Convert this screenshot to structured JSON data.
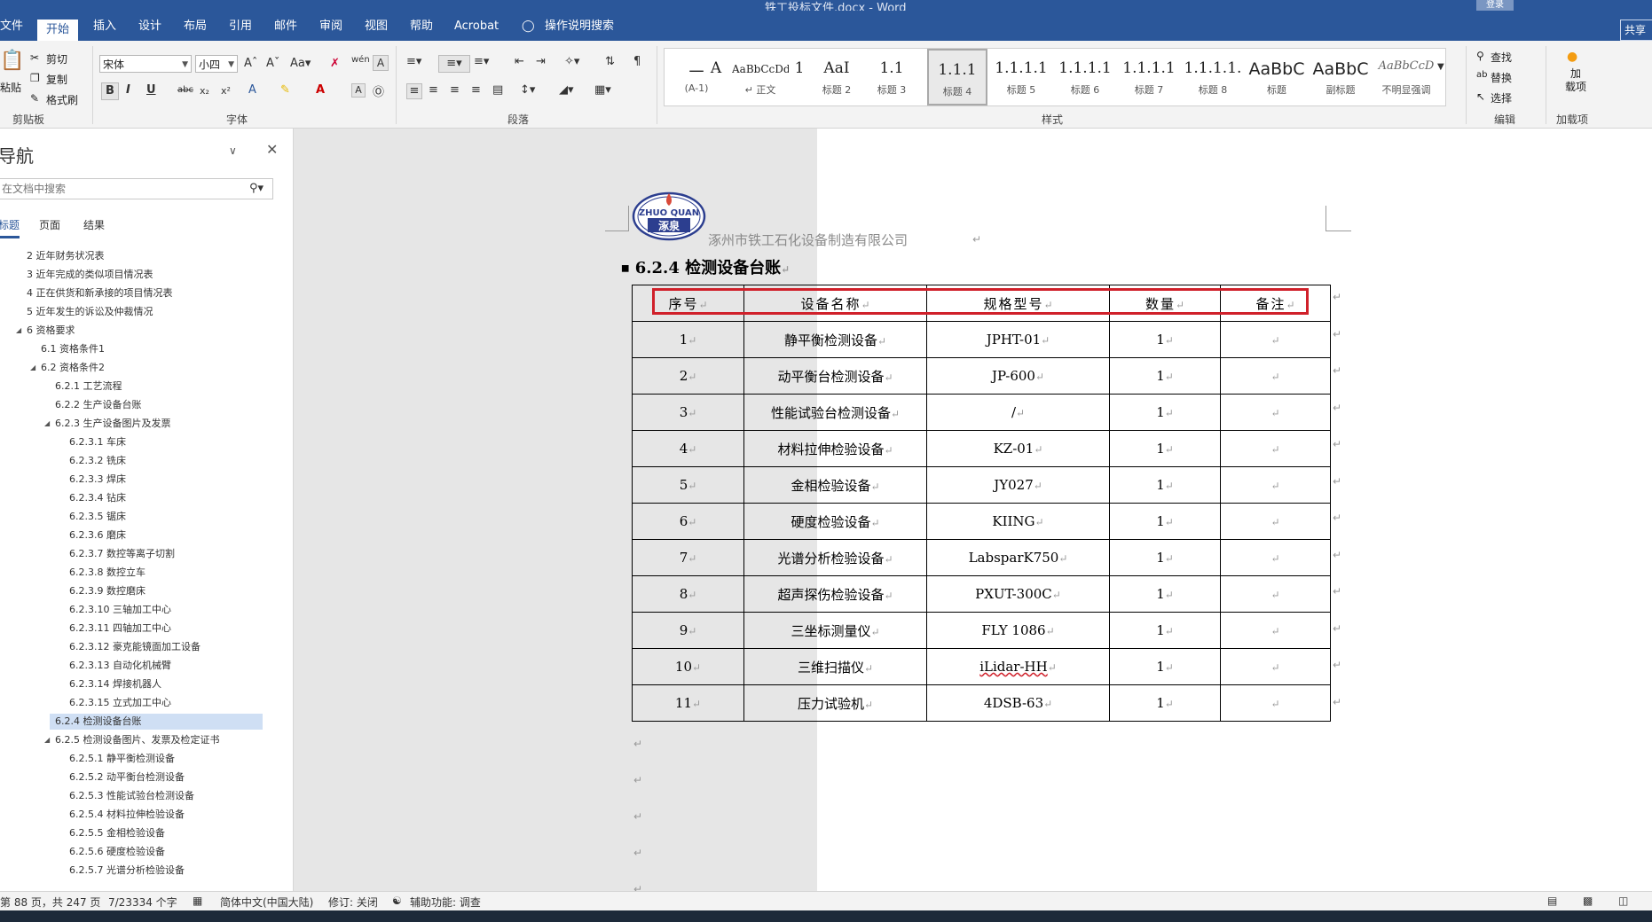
{
  "window": {
    "doc_title": "铁工投标文件.docx  -  Word",
    "login": "登录",
    "share": "共享"
  },
  "tabs": [
    "文件",
    "开始",
    "插入",
    "设计",
    "布局",
    "引用",
    "邮件",
    "审阅",
    "视图",
    "帮助",
    "Acrobat",
    "操作说明搜索"
  ],
  "ribbon": {
    "clipboard": {
      "label": "剪贴板",
      "paste": "粘贴",
      "cut": "剪切",
      "copy": "复制",
      "format_painter": "格式刷"
    },
    "font": {
      "label": "字体",
      "family": "宋体",
      "size": "小四"
    },
    "paragraph": {
      "label": "段落"
    },
    "styles": {
      "label": "样式",
      "items": [
        {
          "sample": "一",
          "name": "(A-1)"
        },
        {
          "sample": "A",
          "name": ""
        },
        {
          "sample": "AaBbCcDdI",
          "name": "↵ 正文"
        },
        {
          "sample": "1",
          "name": ""
        },
        {
          "sample": "AaI",
          "name": "标题 2"
        },
        {
          "sample": "1.1",
          "name": "标题 3"
        },
        {
          "sample": "1.1.1",
          "name": "标题 4"
        },
        {
          "sample": "1.1.1.1",
          "name": "标题 5"
        },
        {
          "sample": "1.1.1.1",
          "name": "标题 6"
        },
        {
          "sample": "1.1.1.1",
          "name": "标题 7"
        },
        {
          "sample": "1.1.1.1.",
          "name": "标题 8"
        },
        {
          "sample": "AaBbC",
          "name": "标题"
        },
        {
          "sample": "AaBbC",
          "name": "副标题"
        },
        {
          "sample": "AaBbCcD",
          "name": "不明显强调"
        }
      ]
    },
    "editing": {
      "label": "编辑",
      "find": "查找",
      "replace": "替换",
      "select": "选择"
    },
    "addins": {
      "label": "加载项",
      "button": "加\n载项"
    }
  },
  "nav": {
    "title": "导航",
    "search_placeholder": "在文档中搜索",
    "tabs": [
      "标题",
      "页面",
      "结果"
    ],
    "items": [
      {
        "text": "2 近年财务状况表",
        "level": 1
      },
      {
        "text": "3 近年完成的类似项目情况表",
        "level": 1
      },
      {
        "text": "4 正在供货和新承接的项目情况表",
        "level": 1
      },
      {
        "text": "5 近年发生的诉讼及仲裁情况",
        "level": 1
      },
      {
        "text": "6 资格要求",
        "level": 1,
        "expanded": true
      },
      {
        "text": "6.1 资格条件1",
        "level": 2
      },
      {
        "text": "6.2 资格条件2",
        "level": 2,
        "expanded": true
      },
      {
        "text": "6.2.1 工艺流程",
        "level": 3
      },
      {
        "text": "6.2.2 生产设备台账",
        "level": 3
      },
      {
        "text": "6.2.3 生产设备图片及发票",
        "level": 3,
        "expanded": true
      },
      {
        "text": "6.2.3.1 车床",
        "level": 4
      },
      {
        "text": "6.2.3.2 铣床",
        "level": 4
      },
      {
        "text": "6.2.3.3 焊床",
        "level": 4
      },
      {
        "text": "6.2.3.4 钻床",
        "level": 4
      },
      {
        "text": "6.2.3.5 锯床",
        "level": 4
      },
      {
        "text": "6.2.3.6 磨床",
        "level": 4
      },
      {
        "text": "6.2.3.7 数控等离子切割",
        "level": 4
      },
      {
        "text": "6.2.3.8 数控立车",
        "level": 4
      },
      {
        "text": "6.2.3.9 数控磨床",
        "level": 4
      },
      {
        "text": "6.2.3.10 三轴加工中心",
        "level": 4
      },
      {
        "text": "6.2.3.11 四轴加工中心",
        "level": 4
      },
      {
        "text": "6.2.3.12 豪克能镜面加工设备",
        "level": 4
      },
      {
        "text": "6.2.3.13 自动化机械臂",
        "level": 4
      },
      {
        "text": "6.2.3.14 焊接机器人",
        "level": 4
      },
      {
        "text": "6.2.3.15 立式加工中心",
        "level": 4
      },
      {
        "text": "6.2.4 检测设备台账",
        "level": 3,
        "selected": true
      },
      {
        "text": "6.2.5 检测设备图片、发票及检定证书",
        "level": 3,
        "expanded": true
      },
      {
        "text": "6.2.5.1 静平衡检测设备",
        "level": 4
      },
      {
        "text": "6.2.5.2 动平衡台检测设备",
        "level": 4
      },
      {
        "text": "6.2.5.3 性能试验台检测设备",
        "level": 4
      },
      {
        "text": "6.2.5.4 材料拉伸检验设备",
        "level": 4
      },
      {
        "text": "6.2.5.5 金相检验设备",
        "level": 4
      },
      {
        "text": "6.2.5.6 硬度检验设备",
        "level": 4
      },
      {
        "text": "6.2.5.7 光谱分析检验设备",
        "level": 4
      }
    ]
  },
  "document": {
    "logo_text_top": "ZHUO QUAN",
    "logo_text_bottom": "涿泉",
    "company": "涿州市铁工石化设备制造有限公司",
    "heading": "6.2.4   检测设备台账",
    "table": {
      "headers": [
        "序号",
        "设备名称",
        "规格型号",
        "数量",
        "备注"
      ],
      "rows": [
        [
          "1",
          "静平衡检测设备",
          "JPHT-01",
          "1",
          ""
        ],
        [
          "2",
          "动平衡台检测设备",
          "JP-600",
          "1",
          ""
        ],
        [
          "3",
          "性能试验台检测设备",
          "/",
          "1",
          ""
        ],
        [
          "4",
          "材料拉伸检验设备",
          "KZ-01",
          "1",
          ""
        ],
        [
          "5",
          "金相检验设备",
          "JY027",
          "1",
          ""
        ],
        [
          "6",
          "硬度检验设备",
          "KIING",
          "1",
          ""
        ],
        [
          "7",
          "光谱分析检验设备",
          "LabsparK750",
          "1",
          ""
        ],
        [
          "8",
          "超声探伤检验设备",
          "PXUT-300C",
          "1",
          ""
        ],
        [
          "9",
          "三坐标测量仪",
          "FLY 1086",
          "1",
          ""
        ],
        [
          "10",
          "三维扫描仪",
          "iLidar-HH",
          "1",
          ""
        ],
        [
          "11",
          "压力试验机",
          "4DSB-63",
          "1",
          ""
        ]
      ]
    },
    "return_mark": "↵"
  },
  "status": {
    "page": "第 88 页，共 247 页",
    "words": "7/23334 个字",
    "lang": "简体中文(中国大陆)",
    "track": "修订: 关闭",
    "accessibility": "辅助功能: 调查"
  },
  "colors": {
    "accent": "#2b579a",
    "highlight_box": "#d0202a"
  }
}
